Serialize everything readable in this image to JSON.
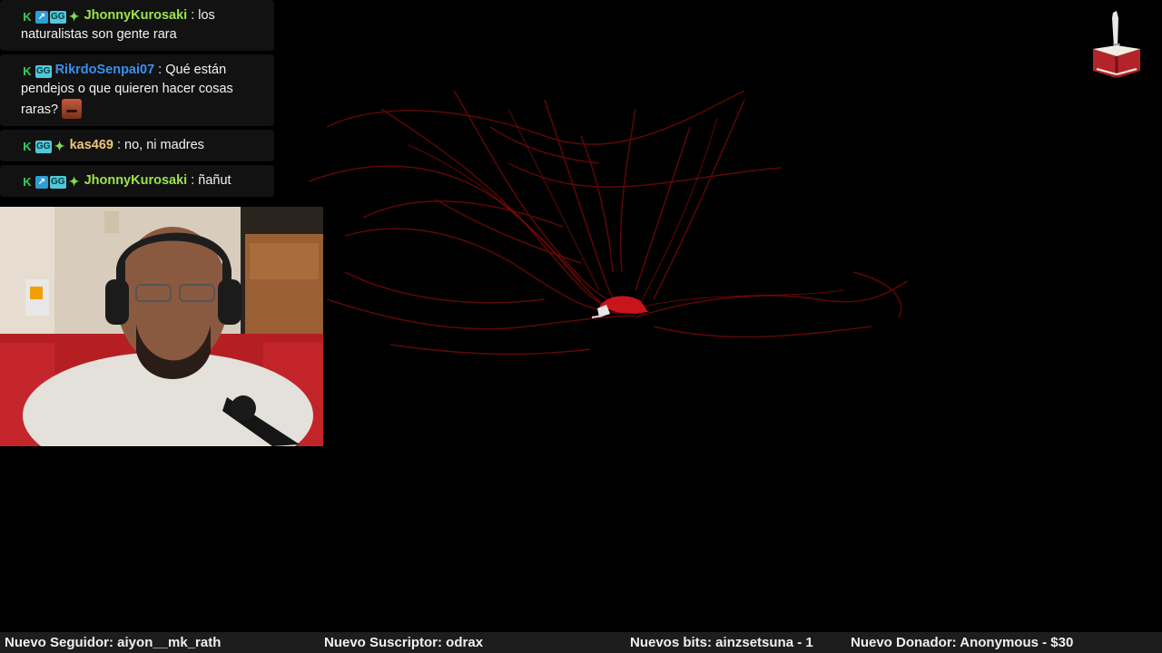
{
  "chat": {
    "messages": [
      {
        "user": "JhonnyKurosaki",
        "user_color": "#9be44b",
        "badges": [
          "k-icon",
          "prime-icon",
          "gg-icon",
          "sparkle-icon"
        ],
        "text": "los naturalistas son gente rara"
      },
      {
        "user": "RikrdoSenpai07",
        "user_color": "#3b8ff0",
        "badges": [
          "k-icon",
          "gg-icon"
        ],
        "text": "Qué están pendejos o que quieren hacer cosas raras?",
        "emote": "mustache-face-emote"
      },
      {
        "user": "kas469",
        "user_color": "#f0c57a",
        "badges": [
          "k-icon",
          "gg-icon",
          "sparkle-icon"
        ],
        "text": "no, ni madres"
      },
      {
        "user": "JhonnyKurosaki",
        "user_color": "#9be44b",
        "badges": [
          "k-icon",
          "prime-icon",
          "gg-icon",
          "sparkle-icon"
        ],
        "text": "ñañut"
      }
    ]
  },
  "ticker": {
    "follower": "Nuevo Seguidor: aiyon__mk_rath",
    "subscriber": "Nuevo Suscriptor: odrax",
    "bits": "Nuevos bits: ainzsetsuna - 1",
    "donor": "Nuevo Donador: Anonymous - $30"
  },
  "colors": {
    "background": "#000000",
    "game_lines": "#7a0a0a",
    "ticker_bg": "#1d1d1d"
  },
  "icons": {
    "logo": "book-quill-icon",
    "player": "red-creature-sprite"
  }
}
